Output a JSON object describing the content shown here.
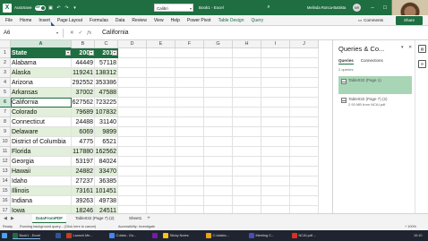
{
  "titlebar": {
    "app_icon": "excel-logo-icon",
    "app_letter": "X",
    "autosave_label": "AutoSave",
    "autosave_state": "Off",
    "font_name": "Calibri",
    "doc_title": "Book1 - Excel",
    "user_name": "Melinda Ronca-Battista",
    "user_initials": "MR",
    "accent_color": "#1e6e41"
  },
  "ribbon_tabs": [
    "File",
    "Home",
    "Insert",
    "Page Layout",
    "Formulas",
    "Data",
    "Review",
    "View",
    "Help",
    "Power Pivot",
    "Table Design",
    "Query"
  ],
  "ribbon_actions": {
    "comments_label": "Comments",
    "share_label": "Share"
  },
  "formula_bar": {
    "name_box": "A6",
    "cancel_glyph": "✕",
    "enter_glyph": "✓",
    "fx_label": "fx",
    "content": "California"
  },
  "sheet": {
    "columns": [
      "A",
      "B",
      "C",
      "D",
      "E",
      "F",
      "G",
      "H",
      "I",
      "J"
    ],
    "row_numbers": [
      "1",
      "2",
      "3",
      "4",
      "5",
      "6",
      "7",
      "8",
      "9",
      "10",
      "11",
      "12",
      "13",
      "14",
      "15",
      "16",
      "17"
    ],
    "selected_column": "A",
    "selected_row": "6",
    "header_row": [
      "State",
      "2000",
      "2010"
    ],
    "rows": [
      [
        "Alabama",
        "44449",
        "57118"
      ],
      [
        "Alaska",
        "119241",
        "138312"
      ],
      [
        "Arizona",
        "292552",
        "353386"
      ],
      [
        "Arkansas",
        "37002",
        "47588"
      ],
      [
        "California",
        "627562",
        "723225"
      ],
      [
        "Colorado",
        "79689",
        "107832"
      ],
      [
        "Connecticut",
        "24488",
        "31140"
      ],
      [
        "Delaware",
        "6069",
        "9899"
      ],
      [
        "District of Columbia",
        "4775",
        "6521"
      ],
      [
        "Florida",
        "117880",
        "162562"
      ],
      [
        "Georgia",
        "53197",
        "84024"
      ],
      [
        "Hawaii",
        "24882",
        "33470"
      ],
      [
        "Idaho",
        "27237",
        "36385"
      ],
      [
        "Illinois",
        "73161",
        "101451"
      ],
      [
        "Indiana",
        "39263",
        "49738"
      ],
      [
        "Iowa",
        "18246",
        "24511"
      ]
    ]
  },
  "queries_panel": {
    "title": "Queries & Co...",
    "tabs": [
      "Queries",
      "Connections"
    ],
    "active_tab": "Queries",
    "count_label": "2 queries",
    "items": [
      {
        "name": "Table032 (Page 1)",
        "sub": ""
      },
      {
        "name": "Table032 (Page 7) (2)",
        "sub": "2.93 MB from NCAI.pdf"
      }
    ]
  },
  "sheet_tabs": {
    "tabs": [
      "DataFromPDF",
      "Table032 (Page 7) (2)",
      "Sheet1"
    ],
    "active": "DataFromPDF",
    "add_glyph": "+"
  },
  "status_bar": {
    "ready": "Ready",
    "background": "Running background query... (Click here to cancel)",
    "accessibility": "Accessibility: Investigate",
    "zoom": "+ 100%"
  },
  "taskbar": {
    "items": [
      {
        "label": "Book1 - Excel",
        "color": "#1e6e41"
      },
      {
        "label": "",
        "color": "#2b579a"
      },
      {
        "label": "Launch Me...",
        "color": "#c43e1c"
      },
      {
        "label": "C:data - Go...",
        "color": "#4285f4"
      },
      {
        "label": "",
        "color": "#7719aa"
      },
      {
        "label": "Sticky Notes",
        "color": "#f5c518"
      },
      {
        "label": "C:\\data\\c...",
        "color": "#e8a317"
      },
      {
        "label": "Meeting C...",
        "color": "#464eb8"
      },
      {
        "label": "NCAI.pdf ...",
        "color": "#d93025"
      }
    ],
    "time": "10:10"
  }
}
